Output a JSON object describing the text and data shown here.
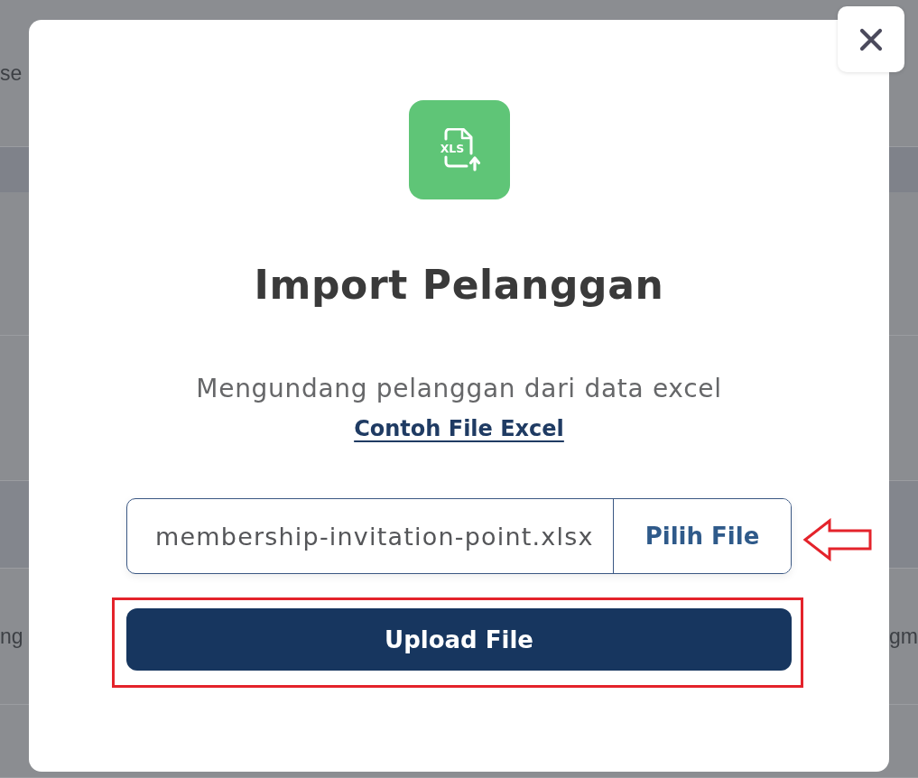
{
  "background_rows": [
    {
      "kind": "row",
      "left": "se"
    },
    {
      "kind": "header"
    },
    {
      "kind": "row"
    },
    {
      "kind": "row"
    },
    {
      "kind": "band"
    },
    {
      "kind": "row",
      "left": "ng",
      "right": "gm"
    },
    {
      "kind": "row"
    }
  ],
  "dialog": {
    "icon_label": "XLS",
    "title": "Import Pelanggan",
    "subtitle": "Mengundang pelanggan dari data excel",
    "sample_link": "Contoh File Excel",
    "file_input": {
      "value": "membership-invitation-point.xlsx",
      "button": "Pilih File"
    },
    "submit_button": "Upload File"
  }
}
